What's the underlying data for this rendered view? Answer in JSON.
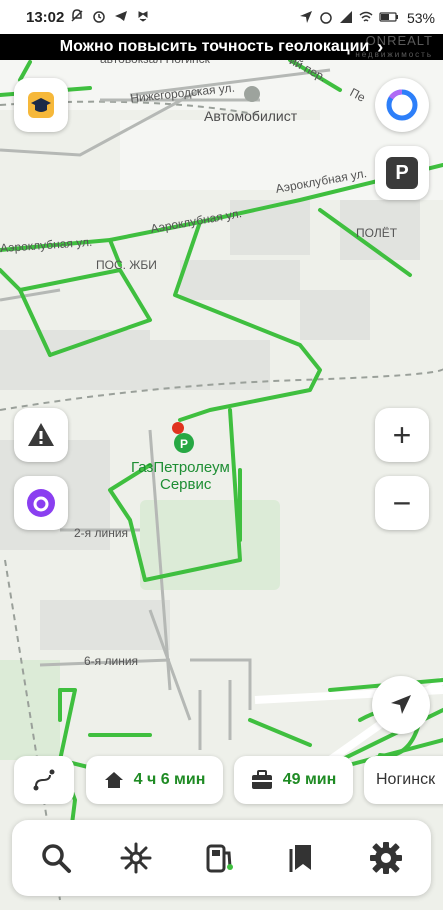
{
  "status_bar": {
    "time": "13:02",
    "battery": "53%"
  },
  "banner": {
    "text": "Можно повысить точность геолокации",
    "chevron": "›",
    "watermark_main": "ONREALT",
    "watermark_sub": "недвижимость"
  },
  "map": {
    "labels": {
      "bus_station": "автовокзал Ногинск",
      "nizhegorodskaya": "Нижегородская ул.",
      "avtomobilist": "Автомобилист",
      "per_left": "ий пер.",
      "per_right": "Пе",
      "aeroklubnaya_1": "Аэроклубная ул.",
      "aeroklubnaya_2": "Аэроклубная ул.",
      "aeroklubnaya_3": "Аэроклубная ул.",
      "polet": "ПОЛЁТ",
      "pos_zhbi": "ПОС. ЖБИ",
      "poi_line1": "ГазПетролеум",
      "poi_line2": "Сервис",
      "liniya_2": "2-я линия",
      "liniya_6": "6-я линия"
    },
    "poi_icon": "gas-station-pin-icon",
    "accent_green": "#3fbf3f",
    "accent_red": "#e0321f"
  },
  "controls": {
    "zoom_in": "+",
    "zoom_out": "−",
    "parking_icon": "P"
  },
  "chips": {
    "home_time": "4 ч 6 мин",
    "work_time": "49 мин",
    "noginsk": "Ногинск"
  },
  "toolbar": {
    "icons": [
      "search-icon",
      "sparkle-icon",
      "gas-pump-icon",
      "bookmarks-icon",
      "settings-icon"
    ]
  }
}
